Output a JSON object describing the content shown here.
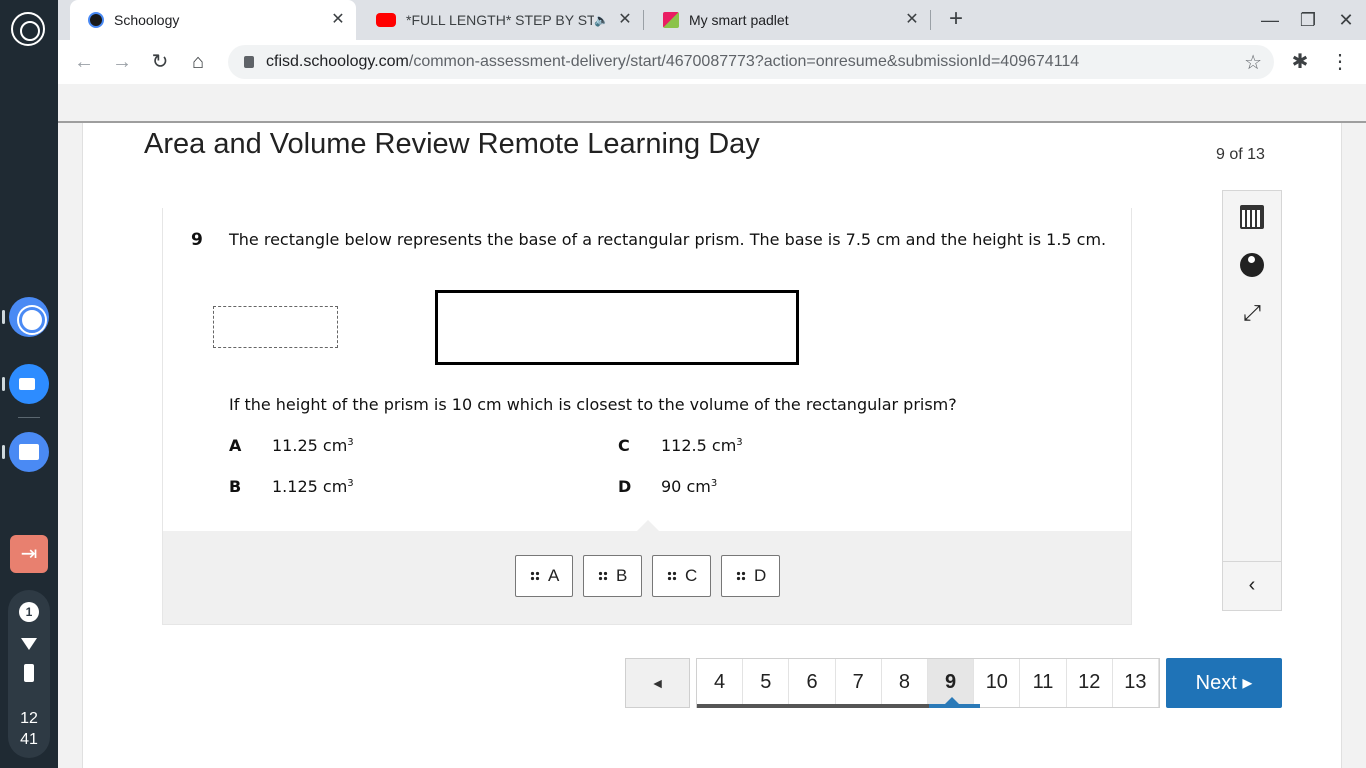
{
  "shelf": {
    "notification_count": "1",
    "clock_hour": "12",
    "clock_minute": "41"
  },
  "browser": {
    "tabs": [
      {
        "title": "Schoology",
        "favicon": "schoology-icon",
        "active": true
      },
      {
        "title": "*FULL LENGTH* STEP BY ST",
        "favicon": "youtube-icon",
        "active": false,
        "audio": true
      },
      {
        "title": "My smart padlet",
        "favicon": "padlet-icon",
        "active": false
      }
    ],
    "url_host": "cfisd.schoology.com",
    "url_path": "/common-assessment-delivery/start/4670087773?action=onresume&submissionId=409674114"
  },
  "assessment": {
    "title": "Area and Volume Review Remote Learning Day",
    "progress": "9 of 13",
    "question_number": "9",
    "stem": "The rectangle below represents the base of a rectangular prism.  The base is 7.5 cm and the height is 1.5 cm.",
    "question": "If the height of the prism is 10 cm which is closest to the volume of the rectangular prism?",
    "options": [
      {
        "letter": "A",
        "value": "11.25 cm",
        "unit_exp": "3"
      },
      {
        "letter": "B",
        "value": "1.125 cm",
        "unit_exp": "3"
      },
      {
        "letter": "C",
        "value": "112.5 cm",
        "unit_exp": "3"
      },
      {
        "letter": "D",
        "value": "90 cm",
        "unit_exp": "3"
      }
    ],
    "drag_choices": [
      "A",
      "B",
      "C",
      "D"
    ]
  },
  "pager": {
    "prev_symbol": "◄",
    "pages": [
      "4",
      "5",
      "6",
      "7",
      "8",
      "9",
      "10",
      "11",
      "12",
      "13"
    ],
    "current": "9",
    "next_label": "Next ▸"
  },
  "colors": {
    "accent": "#1f73b7",
    "shelf_bg": "#1f2a33"
  }
}
